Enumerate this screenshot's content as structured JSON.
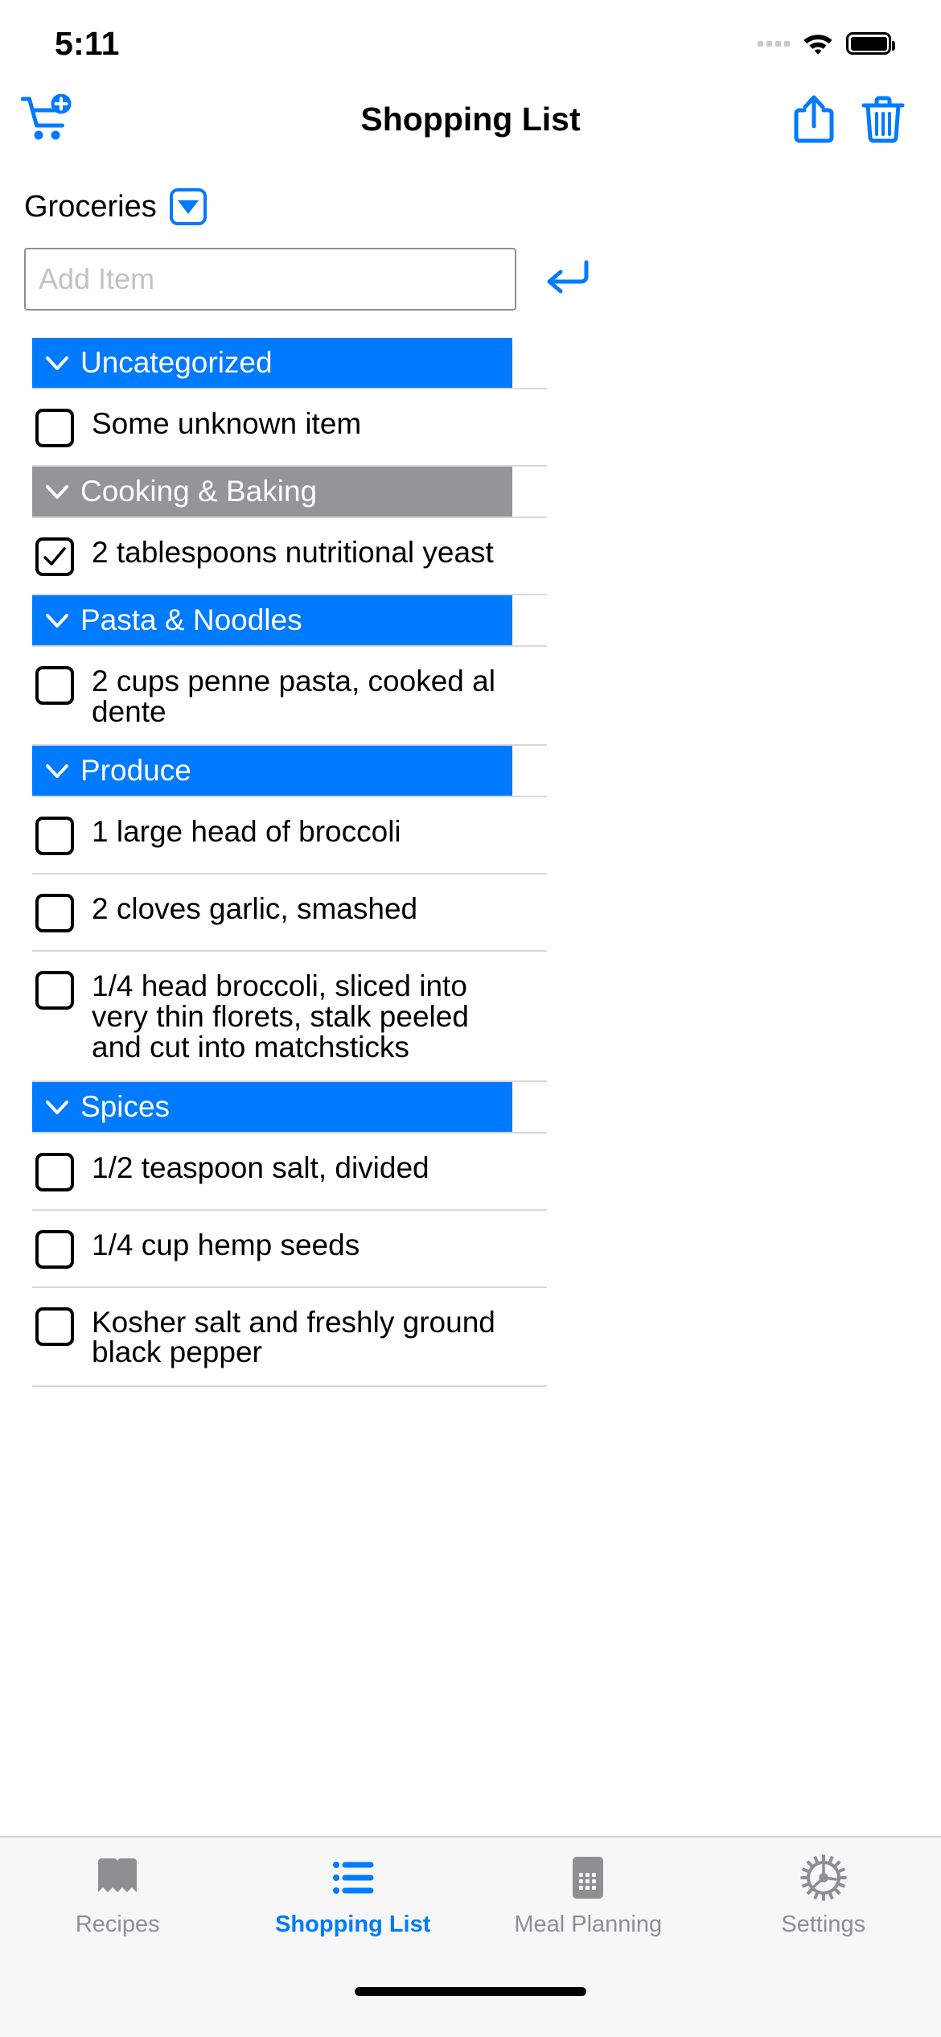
{
  "status_bar": {
    "time": "5:11",
    "signal_icon": "signal-dots-icon",
    "wifi_icon": "wifi-icon",
    "battery_icon": "battery-full-icon"
  },
  "nav_bar": {
    "title": "Shopping List",
    "add_to_cart_icon": "cart-plus-icon",
    "share_icon": "share-icon",
    "delete_icon": "trash-icon"
  },
  "list_picker": {
    "label": "Groceries",
    "dropdown_icon": "chevron-down-icon"
  },
  "add_item": {
    "placeholder": "Add Item",
    "value": "",
    "submit_icon": "return-arrow-icon"
  },
  "colors": {
    "accent": "#007aff",
    "section_blue": "#007aff",
    "section_gray": "#949499",
    "separator": "#d8d8dc",
    "placeholder": "#c2c2c6",
    "inactive_tab": "#8e8e93"
  },
  "sections": [
    {
      "title": "Uncategorized",
      "color": "#007aff",
      "collapse_icon": "chevron-down-icon",
      "items": [
        {
          "text": "Some unknown item",
          "checked": false
        }
      ]
    },
    {
      "title": "Cooking & Baking",
      "color": "#949499",
      "collapse_icon": "chevron-down-icon",
      "items": [
        {
          "text": "2 tablespoons nutritional yeast",
          "checked": true
        }
      ]
    },
    {
      "title": "Pasta & Noodles",
      "color": "#007aff",
      "collapse_icon": "chevron-down-icon",
      "items": [
        {
          "text": "2 cups penne pasta, cooked al dente",
          "checked": false
        }
      ]
    },
    {
      "title": "Produce",
      "color": "#007aff",
      "collapse_icon": "chevron-down-icon",
      "items": [
        {
          "text": "1 large head of broccoli",
          "checked": false
        },
        {
          "text": "2 cloves garlic, smashed",
          "checked": false
        },
        {
          "text": "1/4 head broccoli, sliced into very thin florets, stalk peeled and cut into matchsticks",
          "checked": false
        }
      ]
    },
    {
      "title": "Spices",
      "color": "#007aff",
      "collapse_icon": "chevron-down-icon",
      "items": [
        {
          "text": "1/2 teaspoon salt, divided",
          "checked": false
        },
        {
          "text": "1/4 cup hemp seeds",
          "checked": false
        },
        {
          "text": "Kosher salt and freshly ground black pepper",
          "checked": false
        }
      ]
    }
  ],
  "tab_bar": {
    "tabs": [
      {
        "label": "Recipes",
        "icon": "book-icon",
        "active": false
      },
      {
        "label": "Shopping List",
        "icon": "list-icon",
        "active": true
      },
      {
        "label": "Meal Planning",
        "icon": "calendar-icon",
        "active": false
      },
      {
        "label": "Settings",
        "icon": "gear-icon",
        "active": false
      }
    ]
  }
}
